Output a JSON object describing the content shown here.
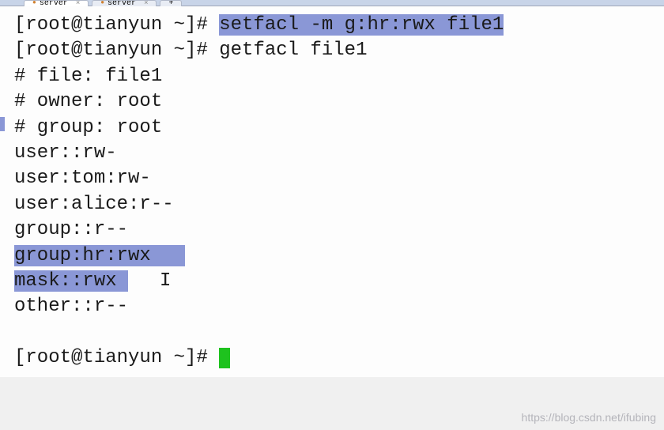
{
  "tabs": {
    "tab1": {
      "icon": "●",
      "label": "server"
    },
    "tab2": {
      "icon": "●",
      "label": "server"
    },
    "add": "+"
  },
  "terminal": {
    "prompt": "[root@tianyun ~]# ",
    "cmd1": "setfacl -m g:hr:rwx file1",
    "cmd2": "getfacl file1",
    "out_file": "# file: file1",
    "out_owner": "# owner: root",
    "out_group": "# group: root",
    "out_user": "user::rw-",
    "out_user_tom": "user:tom:rw-",
    "out_user_alice": "user:alice:r--",
    "out_group_def": "group::r--",
    "out_group_hr": "group:hr:rwx",
    "out_mask": "mask::rwx",
    "out_other": "other::r--",
    "text_cursor": "I"
  },
  "watermark": "https://blog.csdn.net/ifubing"
}
